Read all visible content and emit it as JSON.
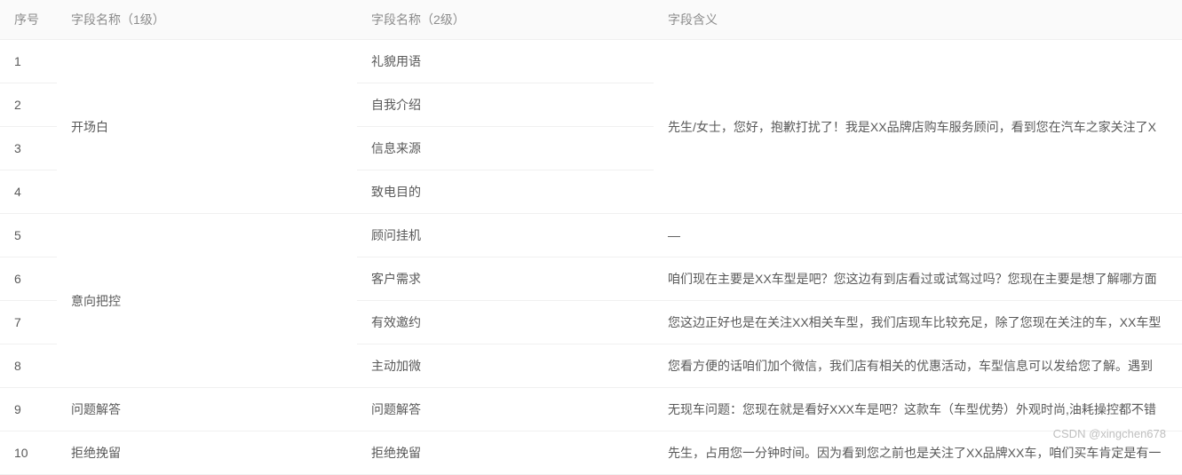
{
  "headers": {
    "seq": "序号",
    "l1": "字段名称（1级）",
    "l2": "字段名称（2级）",
    "meaning": "字段含义"
  },
  "groups": [
    {
      "l1": "开场白",
      "meaning": "先生/女士，您好，抱歉打扰了！我是XX品牌店购车服务顾问，看到您在汽车之家关注了X",
      "rows": [
        {
          "seq": "1",
          "l2": "礼貌用语"
        },
        {
          "seq": "2",
          "l2": "自我介绍"
        },
        {
          "seq": "3",
          "l2": "信息来源"
        },
        {
          "seq": "4",
          "l2": "致电目的"
        }
      ]
    },
    {
      "l1": "意向把控",
      "rows": [
        {
          "seq": "5",
          "l2": "顾问挂机",
          "meaning": "—"
        },
        {
          "seq": "6",
          "l2": "客户需求",
          "meaning": "咱们现在主要是XX车型是吧？您这边有到店看过或试驾过吗？您现在主要是想了解哪方面"
        },
        {
          "seq": "7",
          "l2": "有效邀约",
          "meaning": "您这边正好也是在关注XX相关车型，我们店现车比较充足，除了您现在关注的车，XX车型"
        },
        {
          "seq": "8",
          "l2": "主动加微",
          "meaning": "您看方便的话咱们加个微信，我们店有相关的优惠活动，车型信息可以发给您了解。遇到"
        }
      ]
    },
    {
      "l1": "问题解答",
      "rows": [
        {
          "seq": "9",
          "l2": "问题解答",
          "meaning": "无现车问题：您现在就是看好XXX车是吧？这款车（车型优势）外观时尚,油耗操控都不错"
        }
      ]
    },
    {
      "l1": "拒绝挽留",
      "rows": [
        {
          "seq": "10",
          "l2": "拒绝挽留",
          "meaning": "先生，占用您一分钟时间。因为看到您之前也是关注了XX品牌XX车，咱们买车肯定是有一"
        }
      ]
    }
  ],
  "watermark": "CSDN @xingchen678"
}
